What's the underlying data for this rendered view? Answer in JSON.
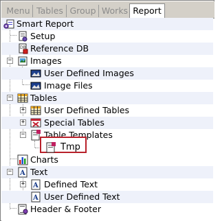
{
  "tabs": [
    {
      "label": "Menu"
    },
    {
      "label": "Tables"
    },
    {
      "label": "Group"
    },
    {
      "label": "Works"
    },
    {
      "label": "Report"
    }
  ],
  "tree": {
    "root": "Smart Report",
    "setup": "Setup",
    "reference_db": "Reference DB",
    "images": "Images",
    "user_defined_images": "User Defined Images",
    "image_files": "Image Files",
    "tables": "Tables",
    "user_defined_tables": "User Defined Tables",
    "special_tables": "Special Tables",
    "table_templates": "Table Templates",
    "tmp": "Tmp",
    "charts": "Charts",
    "text": "Text",
    "defined_text": "Defined Text",
    "user_defined_text": "User Defined Text",
    "header_footer": "Header & Footer"
  },
  "expander_symbols": {
    "collapsed": "+",
    "expanded": "−"
  }
}
